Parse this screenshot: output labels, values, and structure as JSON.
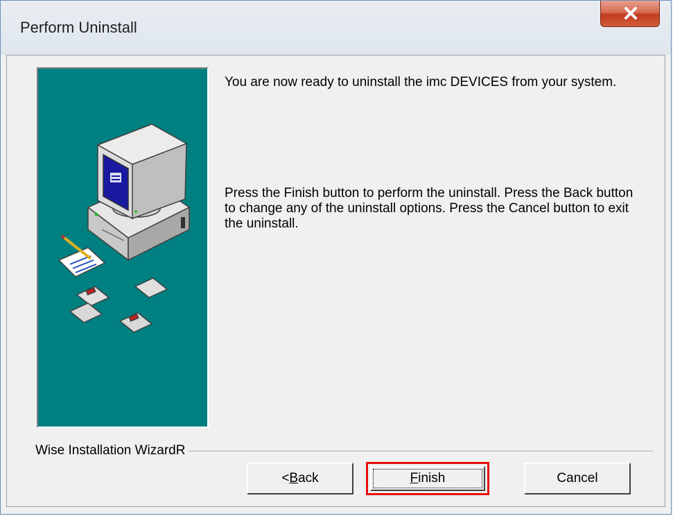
{
  "window": {
    "title": "Perform Uninstall",
    "close_symbol": "✕"
  },
  "panel": {
    "illustration": "computer-install-illustration"
  },
  "messages": {
    "ready": "You are now ready to uninstall the imc DEVICES from your system.",
    "instructions": "Press the Finish button to perform the uninstall. Press the Back button to change any of the uninstall options. Press the Cancel button to exit the uninstall."
  },
  "footer": {
    "wizard_label": "Wise Installation WizardR"
  },
  "buttons": {
    "back_prefix": "< ",
    "back_key": "B",
    "back_rest": "ack",
    "finish_key": "F",
    "finish_rest": "inish",
    "cancel": "Cancel"
  },
  "colors": {
    "panel_bg": "#008080",
    "highlight": "#e81010",
    "close_button": "#c23a1e"
  }
}
